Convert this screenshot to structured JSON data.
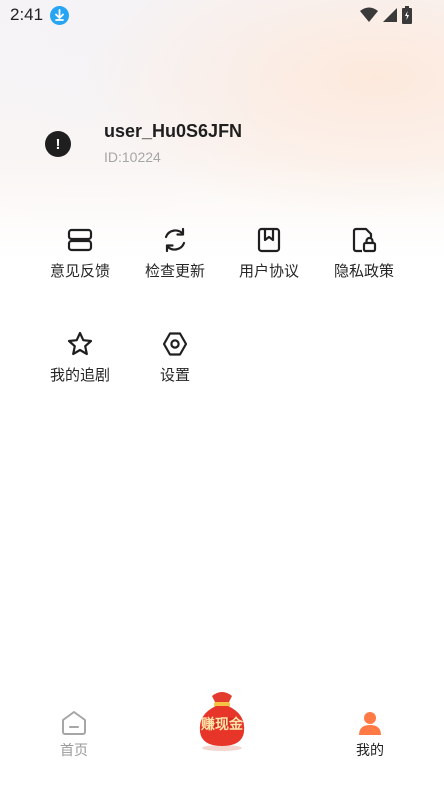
{
  "status_bar": {
    "time": "2:41"
  },
  "profile": {
    "username": "user_Hu0S6JFN",
    "id": "ID:10224",
    "avatar_glyph": "!"
  },
  "menu": {
    "items": [
      {
        "label": "意见反馈",
        "icon": "feedback-icon"
      },
      {
        "label": "检查更新",
        "icon": "refresh-icon"
      },
      {
        "label": "用户协议",
        "icon": "bookmark-icon"
      },
      {
        "label": "隐私政策",
        "icon": "privacy-lock-icon"
      },
      {
        "label": "我的追剧",
        "icon": "star-icon"
      },
      {
        "label": "设置",
        "icon": "hexagon-settings-icon"
      }
    ]
  },
  "bottom_nav": {
    "home_label": "首页",
    "center_label": "赚现金",
    "mine_label": "我的"
  },
  "colors": {
    "accent": "#ff7a45",
    "inactive": "#9a9a9a",
    "download_badge": "#27a5f2"
  }
}
